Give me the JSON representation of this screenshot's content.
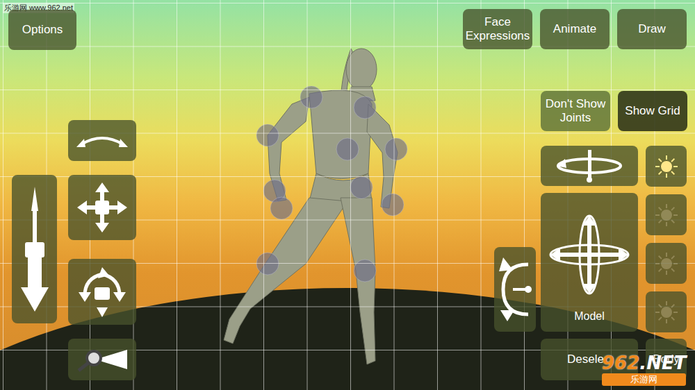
{
  "watermark_top": "乐游网 www.962.net",
  "watermark_bottom": {
    "number": "962",
    "suffix": ".NET",
    "name": "乐游网"
  },
  "viewport": {
    "grid_visible": true,
    "joints_visible": true
  },
  "options_button": {
    "label": "Options"
  },
  "top_buttons": [
    {
      "label": "Face Expressions"
    },
    {
      "label": "Animate"
    },
    {
      "label": "Draw"
    }
  ],
  "toggles": [
    {
      "label": "Don't Show Joints",
      "selected": false
    },
    {
      "label": "Show Grid",
      "selected": true
    }
  ],
  "camera_controls": [
    {
      "kind": "orbit"
    },
    {
      "kind": "dolly"
    },
    {
      "kind": "pan"
    },
    {
      "kind": "tilt"
    },
    {
      "kind": "zoom"
    }
  ],
  "model_controls": {
    "label": "Model",
    "rotators": [
      {
        "kind": "spin"
      },
      {
        "kind": "roll"
      }
    ]
  },
  "lights": [
    {
      "on": true
    },
    {
      "on": false
    },
    {
      "on": false
    },
    {
      "on": false
    }
  ],
  "bottom_buttons": [
    {
      "label": "Desele"
    },
    {
      "label": "Body"
    }
  ]
}
